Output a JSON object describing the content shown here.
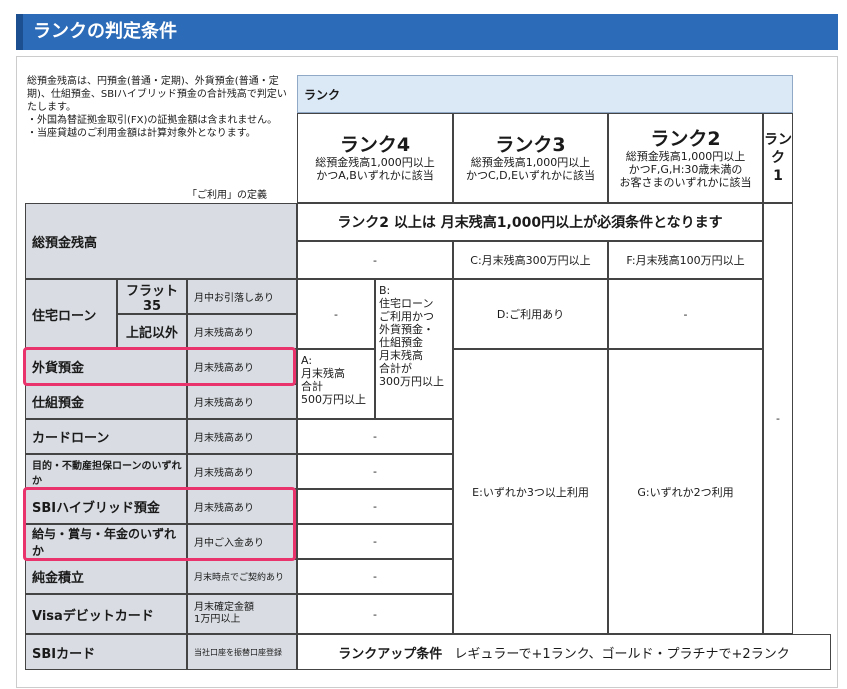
{
  "header": {
    "title": "ランクの判定条件"
  },
  "notes": {
    "text": "総預金残高は、円預金(普通・定期)、外貨預金(普通・定期)、仕組預金、SBIハイブリッド預金の合計残高で判定いたします。\n・外国為替証拠金取引(FX)の証拠金額は含まれません。\n・当座貸越のご利用金額は計算対象外となります。",
    "definition_label": "「ご利用」の定義"
  },
  "rank_header": "ランク",
  "ranks": [
    {
      "name": "ランク4",
      "desc": "総預金残高1,000円以上\nかつA,Bいずれかに該当"
    },
    {
      "name": "ランク3",
      "desc": "総預金残高1,000円以上\nかつC,D,Eいずれかに該当"
    },
    {
      "name": "ランク2",
      "desc": "総預金残高1,000円以上\nかつF,G,H:30歳未満の\nお客さまのいずれかに該当"
    },
    {
      "name": "ランク\n1",
      "desc": ""
    }
  ],
  "total_deposit": {
    "label": "総預金残高",
    "banner": "ランク2 以上は 月末残高1,000円以上が必須条件となります",
    "r4r3": "-",
    "c": "C:月末残高300万円以上",
    "f": "F:月末残高100万円以上"
  },
  "housing_loan": {
    "label": "住宅ローン",
    "sub": [
      {
        "label": "フラット35",
        "cond": "月中お引落しあり"
      },
      {
        "label": "上記以外",
        "cond": "月末残高あり"
      }
    ],
    "r4": "-",
    "d": "D:ご利用あり",
    "r2": "-"
  },
  "b_condition": "B:\n住宅ローン\nご利用かつ\n外貨預金・\n仕組預金\n月末残高\n合計が\n300万円以上",
  "a_condition": "A:\n月末残高\n合計\n500万円以上",
  "products": [
    {
      "label": "外貨預金",
      "cond": "月末残高あり"
    },
    {
      "label": "仕組預金",
      "cond": "月末残高あり"
    },
    {
      "label": "カードローン",
      "cond": "月末残高あり",
      "value": "-"
    },
    {
      "label": "目的・不動産担保ローンのいずれか",
      "cond": "月末残高あり",
      "value": "-"
    },
    {
      "label": "SBIハイブリッド預金",
      "cond": "月末残高あり",
      "value": "-"
    },
    {
      "label": "給与・賞与・年金のいずれか",
      "cond": "月中ご入金あり",
      "value": "-"
    },
    {
      "label": "純金積立",
      "cond": "月末時点でご契約あり",
      "value": "-"
    },
    {
      "label": "Visaデビットカード",
      "cond": "月末確定金額\n1万円以上",
      "value": "-"
    }
  ],
  "e_condition": "E:いずれか3つ以上利用",
  "g_condition": "G:いずれか2つ利用",
  "rank1_value": "-",
  "sbi_card": {
    "label": "SBIカード",
    "cond": "当社口座を振替口座登録",
    "rankup_label": "ランクアップ条件",
    "rankup_text": "レギュラーで+1ランク、ゴールド・プラチナで+2ランク"
  },
  "colors": {
    "header_bg": "#2c6bb8",
    "highlight": "#e8336d",
    "label_bg": "#d9dde3",
    "rank_header_bg": "#dbe8f5"
  }
}
